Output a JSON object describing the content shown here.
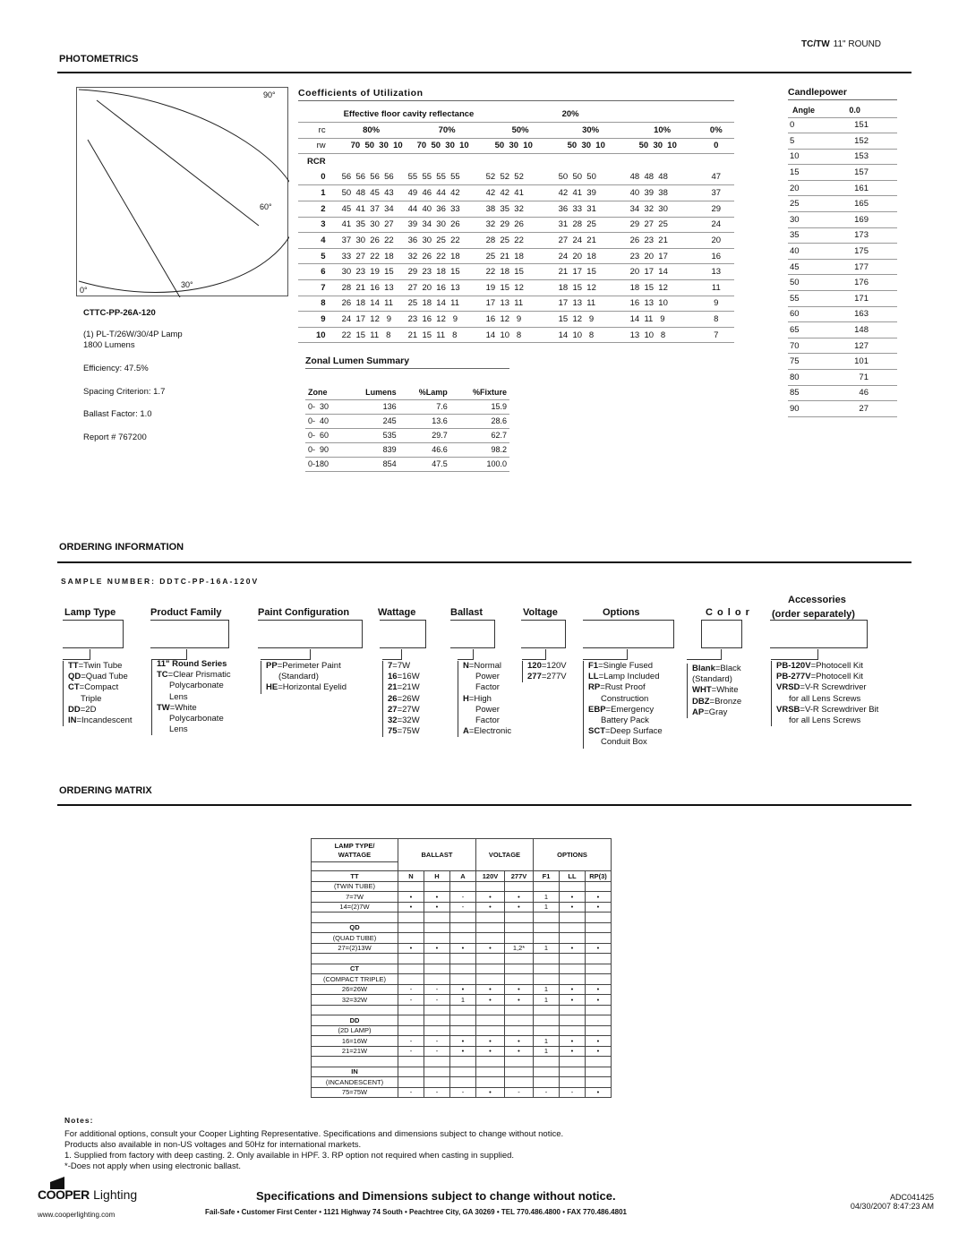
{
  "header": {
    "product_code": "TC/TW",
    "product_name": "11\" ROUND",
    "section_photometrics": "PHOTOMETRICS"
  },
  "polar": {
    "labels": {
      "a90": "90°",
      "a60": "60°",
      "a30": "30°",
      "a0": "0°"
    }
  },
  "lamp": {
    "catalog": "CTTC-PP-26A-120",
    "lamp_line1": "(1) PL-T/26W/30/4P Lamp",
    "lamp_line2": "1800 Lumens",
    "efficiency": "Efficiency: 47.5%",
    "spacing": "Spacing Criterion: 1.7",
    "ballast_factor": "Ballast Factor:  1.0",
    "report": "Report # 767200"
  },
  "cu": {
    "title": "Coefficients of Utilization",
    "floor_label": "Effective floor cavity reflectance",
    "floor_value": "20%",
    "rc_label": "rc",
    "rc_values": [
      "80%",
      "70%",
      "50%",
      "30%",
      "10%",
      "0%"
    ],
    "rw_label": "rw",
    "rw_values": [
      "70  50  30  10",
      "70  50  30  10",
      "50  30  10",
      "50  30  10",
      "50  30  10",
      "0"
    ],
    "rcr_label": "RCR",
    "rows": [
      {
        "rcr": "0",
        "g": [
          "56  56  56  56",
          "55  55  55  55",
          "52  52  52",
          "50  50  50",
          "48  48  48",
          "47"
        ]
      },
      {
        "rcr": "1",
        "g": [
          "50  48  45  43",
          "49  46  44  42",
          "42  42  41",
          "42  41  39",
          "40  39  38",
          "37"
        ]
      },
      {
        "rcr": "2",
        "g": [
          "45  41  37  34",
          "44  40  36  33",
          "38  35  32",
          "36  33  31",
          "34  32  30",
          "29"
        ]
      },
      {
        "rcr": "3",
        "g": [
          "41  35  30  27",
          "39  34  30  26",
          "32  29  26",
          "31  28  25",
          "29  27  25",
          "24"
        ]
      },
      {
        "rcr": "4",
        "g": [
          "37  30  26  22",
          "36  30  25  22",
          "28  25  22",
          "27  24  21",
          "26  23  21",
          "20"
        ]
      },
      {
        "rcr": "5",
        "g": [
          "33  27  22  18",
          "32  26  22  18",
          "25  21  18",
          "24  20  18",
          "23  20  17",
          "16"
        ]
      },
      {
        "rcr": "6",
        "g": [
          "30  23  19  15",
          "29  23  18  15",
          "22  18  15",
          "21  17  15",
          "20  17  14",
          "13"
        ]
      },
      {
        "rcr": "7",
        "g": [
          "28  21  16  13",
          "27  20  16  13",
          "19  15  12",
          "18  15  12",
          "18  15  12",
          "11"
        ]
      },
      {
        "rcr": "8",
        "g": [
          "26  18  14  11",
          "25  18  14  11",
          "17  13  11",
          "17  13  11",
          "16  13  10",
          "9"
        ]
      },
      {
        "rcr": "9",
        "g": [
          "24  17  12   9",
          "23  16  12   9",
          "16  12   9",
          "15  12   9",
          "14  11   9",
          "8"
        ]
      },
      {
        "rcr": "10",
        "g": [
          "22  15  11   8",
          "21  15  11   8",
          "14  10   8",
          "14  10   8",
          "13  10   8",
          "7"
        ]
      }
    ]
  },
  "candlepower": {
    "title": "Candlepower",
    "col_angle": "Angle",
    "col_value": "0.0",
    "rows": [
      [
        "0",
        "151"
      ],
      [
        "5",
        "152"
      ],
      [
        "10",
        "153"
      ],
      [
        "15",
        "157"
      ],
      [
        "20",
        "161"
      ],
      [
        "25",
        "165"
      ],
      [
        "30",
        "169"
      ],
      [
        "35",
        "173"
      ],
      [
        "40",
        "175"
      ],
      [
        "45",
        "177"
      ],
      [
        "50",
        "176"
      ],
      [
        "55",
        "171"
      ],
      [
        "60",
        "163"
      ],
      [
        "65",
        "148"
      ],
      [
        "70",
        "127"
      ],
      [
        "75",
        "101"
      ],
      [
        "80",
        "71"
      ],
      [
        "85",
        "46"
      ],
      [
        "90",
        "27"
      ]
    ]
  },
  "zonal": {
    "title": "Zonal Lumen Summary",
    "headers": [
      "Zone",
      "Lumens",
      "%Lamp",
      "%Fixture"
    ],
    "rows": [
      [
        "0-  30",
        "136",
        "7.6",
        "15.9"
      ],
      [
        "0-  40",
        "245",
        "13.6",
        "28.6"
      ],
      [
        "0-  60",
        "535",
        "29.7",
        "62.7"
      ],
      [
        "0-  90",
        "839",
        "46.6",
        "98.2"
      ],
      [
        "0-180",
        "854",
        "47.5",
        "100.0"
      ]
    ]
  },
  "ordering": {
    "title": "ORDERING INFORMATION",
    "sample": "SAMPLE NUMBER: DDTC-PP-16A-120V",
    "columns": {
      "lamp_type": "Lamp Type",
      "product_family": "Product Family",
      "paint": "Paint Configuration",
      "wattage": "Wattage",
      "ballast": "Ballast",
      "voltage": "Voltage",
      "options": "Options",
      "color": "C o l o r",
      "accessories_1": "Accessories",
      "accessories_2": "(order separately)"
    },
    "lamp_type": [
      [
        "TT",
        "=Twin Tube"
      ],
      [
        "QD",
        "=Quad Tube"
      ],
      [
        "CT",
        "=Compact"
      ],
      [
        "",
        "Triple"
      ],
      [
        "DD",
        "=2D"
      ],
      [
        "IN",
        "=Incandescent"
      ]
    ],
    "product_family": [
      [
        "11\" Round Series",
        ""
      ],
      [
        "TC",
        "=Clear Prismatic"
      ],
      [
        "",
        "Polycarbonate"
      ],
      [
        "",
        "Lens"
      ],
      [
        "TW",
        "=White"
      ],
      [
        "",
        "Polycarbonate"
      ],
      [
        "",
        "Lens"
      ]
    ],
    "paint": [
      [
        "PP",
        "=Perimeter Paint"
      ],
      [
        "",
        "(Standard)"
      ],
      [
        "HE",
        "=Horizontal Eyelid"
      ]
    ],
    "wattage": [
      [
        "7",
        "=7W"
      ],
      [
        "16",
        "=16W"
      ],
      [
        "21",
        "=21W"
      ],
      [
        "26",
        "=26W"
      ],
      [
        "27",
        "=27W"
      ],
      [
        "32",
        "=32W"
      ],
      [
        "75",
        "=75W"
      ]
    ],
    "ballast": [
      [
        "N",
        "=Normal"
      ],
      [
        "",
        "Power"
      ],
      [
        "",
        "Factor"
      ],
      [
        "H",
        "=High"
      ],
      [
        "",
        "Power"
      ],
      [
        "",
        "Factor"
      ],
      [
        "A",
        "=Electronic"
      ]
    ],
    "voltage": [
      [
        "120",
        "=120V"
      ],
      [
        "277",
        "=277V"
      ]
    ],
    "options": [
      [
        "F1",
        "=Single Fused"
      ],
      [
        "LL",
        "=Lamp Included"
      ],
      [
        "RP",
        "=Rust Proof"
      ],
      [
        "",
        "Construction"
      ],
      [
        "EBP",
        "=Emergency"
      ],
      [
        "",
        "Battery Pack"
      ],
      [
        "SCT",
        "=Deep Surface"
      ],
      [
        "",
        "Conduit Box"
      ]
    ],
    "color": [
      [
        "Blank",
        "=Black"
      ],
      [
        "",
        "(Standard)"
      ],
      [
        "WHT",
        "=White"
      ],
      [
        "DBZ",
        "=Bronze"
      ],
      [
        "AP",
        "=Gray"
      ]
    ],
    "accessories": [
      [
        "PB-120V",
        "=Photocell Kit"
      ],
      [
        "PB-277V",
        "=Photocell Kit"
      ],
      [
        "VRSD",
        "=V-R Screwdriver"
      ],
      [
        "",
        "for all Lens Screws"
      ],
      [
        "VRSB",
        "=V-R Screwdriver Bit"
      ],
      [
        "",
        "for all Lens Screws"
      ]
    ]
  },
  "matrix": {
    "title": "ORDERING MATRIX",
    "group_headers": [
      "LAMP TYPE/\nWATTAGE",
      "BALLAST",
      "VOLTAGE",
      "OPTIONS"
    ],
    "sub_headers": [
      "TT",
      "N",
      "H",
      "A",
      "120V",
      "277V",
      "F1",
      "LL",
      "RP(3)"
    ],
    "rows": [
      [
        "(TWIN TUBE)",
        "",
        "",
        "",
        "",
        "",
        "",
        "",
        ""
      ],
      [
        "7=7W",
        "•",
        "•",
        "-",
        "•",
        "•",
        "1",
        "•",
        "•"
      ],
      [
        "14=(2)7W",
        "•",
        "•",
        "-",
        "•",
        "•",
        "1",
        "•",
        "•"
      ],
      [
        "",
        "",
        "",
        "",
        "",
        "",
        "",
        "",
        ""
      ],
      [
        "QD",
        "",
        "",
        "",
        "",
        "",
        "",
        "",
        ""
      ],
      [
        "(QUAD TUBE)",
        "",
        "",
        "",
        "",
        "",
        "",
        "",
        ""
      ],
      [
        "27=(2)13W",
        "•",
        "•",
        "•",
        "•",
        "1,2*",
        "1",
        "•",
        "•"
      ],
      [
        "",
        "",
        "",
        "",
        "",
        "",
        "",
        "",
        ""
      ],
      [
        "CT",
        "",
        "",
        "",
        "",
        "",
        "",
        "",
        ""
      ],
      [
        "(COMPACT TRIPLE)",
        "",
        "",
        "",
        "",
        "",
        "",
        "",
        ""
      ],
      [
        "26=26W",
        "-",
        "-",
        "•",
        "•",
        "•",
        "1",
        "•",
        "•"
      ],
      [
        "32=32W",
        "-",
        "-",
        "1",
        "•",
        "•",
        "1",
        "•",
        "•"
      ],
      [
        "",
        "",
        "",
        "",
        "",
        "",
        "",
        "",
        ""
      ],
      [
        "DD",
        "",
        "",
        "",
        "",
        "",
        "",
        "",
        ""
      ],
      [
        "(2D LAMP)",
        "",
        "",
        "",
        "",
        "",
        "",
        "",
        ""
      ],
      [
        "16=16W",
        "-",
        "-",
        "•",
        "•",
        "•",
        "1",
        "•",
        "•"
      ],
      [
        "21=21W",
        "-",
        "-",
        "•",
        "•",
        "•",
        "1",
        "•",
        "•"
      ],
      [
        "",
        "",
        "",
        "",
        "",
        "",
        "",
        "",
        ""
      ],
      [
        "IN",
        "",
        "",
        "",
        "",
        "",
        "",
        "",
        ""
      ],
      [
        "(INCANDESCENT)",
        "",
        "",
        "",
        "",
        "",
        "",
        "",
        ""
      ],
      [
        "75=75W",
        "-",
        "-",
        "-",
        "•",
        "-",
        "-",
        "-",
        "•"
      ]
    ],
    "bold_rows": [
      4,
      8,
      13,
      18
    ]
  },
  "notes": {
    "title": "Notes:",
    "lines": [
      "For additional options, consult your Cooper Lighting Representative. Specifications and dimensions subject to change without notice.",
      "Products also available in non-US voltages and 50Hz for international markets.",
      "1. Supplied from factory with deep casting. 2. Only available in HPF. 3. RP option not required when casting in supplied.",
      "*-Does not apply when using electronic ballast."
    ]
  },
  "footer": {
    "brand": "COOPER",
    "brand_suffix": "Lighting",
    "url": "www.cooperlighting.com",
    "headline": "Specifications and Dimensions subject to change without notice.",
    "address": "Fail-Safe • Customer First Center • 1121 Highway 74 South • Peachtree City, GA 30269 • TEL 770.486.4800 • FAX 770.486.4801",
    "doc_id": "ADC041425",
    "timestamp": "04/30/2007 8:47:23 AM"
  }
}
